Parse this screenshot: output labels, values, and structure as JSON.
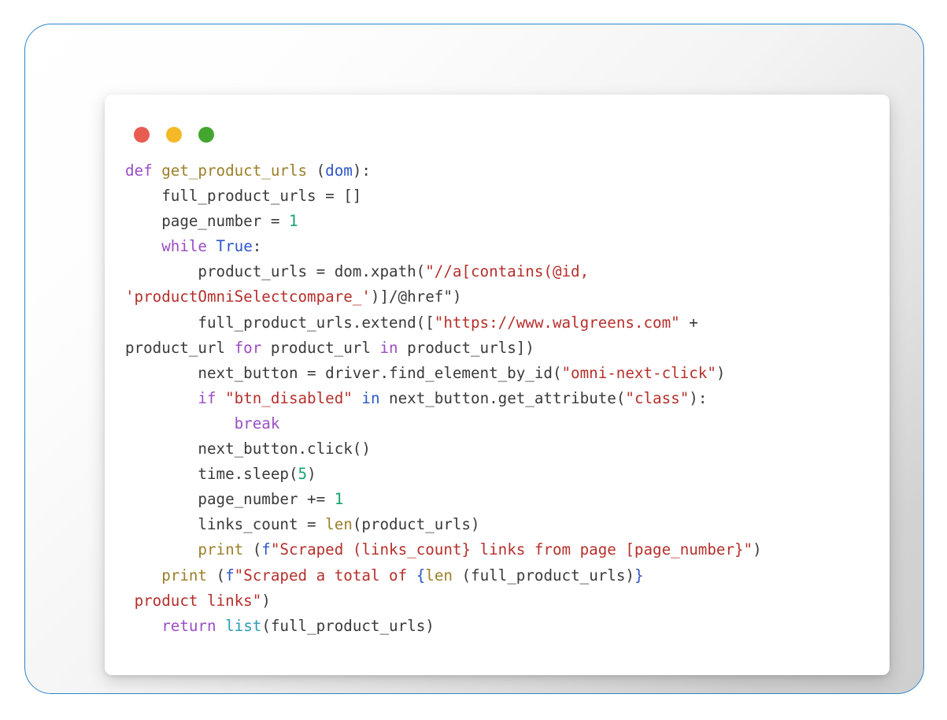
{
  "window": {
    "title": "Code snippet",
    "dots": [
      {
        "name": "close-dot",
        "color": "#e85c52"
      },
      {
        "name": "minimize-dot",
        "color": "#f5b928"
      },
      {
        "name": "maximize-dot",
        "color": "#43a62f"
      }
    ]
  },
  "frame": {
    "border_color": "#2e86c8",
    "background_gradient_from": "#ffffff",
    "background_gradient_to": "#cfcfcf"
  },
  "theme": {
    "card_background": "#ffffff",
    "text_color": "#3a3a3a",
    "keyword_color": "#9a4ec4",
    "keyword_alt_color": "#2c56c9",
    "function_color": "#9b8029",
    "string_color": "#b5302b",
    "number_color": "#13a36b",
    "builtin_color": "#2a9bb5"
  },
  "code": {
    "language": "python",
    "plain_text": "def get_product_urls (dom):\n    full_product_urls = []\n    page_number = 1\n    while True:\n        product_urls = dom.xpath(\"//a[contains(@id,\n'productOmniSelectcompare_')]/@href\")\n        full_product_urls.extend([\"https://www.walgreens.com\" +\nproduct_url for product_url in product_urls])\n        next_button = driver.find_element_by_id(\"omni-next-click\")\n        if \"btn_disabled\" in next_button.get_attribute(\"class\"):\n            break\n        next_button.click()\n        time.sleep(5)\n        page_number += 1\n        links_count = len(product_urls)\n        print (f\"Scraped (links_count} links from page [page_number}\")\n    print (f\"Scraped a total of {len (full_product_urls)}\n product links\")\n    return list(full_product_urls)",
    "lines": [
      "def get_product_urls (dom):",
      "    full_product_urls = []",
      "    page_number = 1",
      "    while True:",
      "        product_urls = dom.xpath(\"//a[contains(@id,",
      "'productOmniSelectcompare_')]/@href\")",
      "        full_product_urls.extend([\"https://www.walgreens.com\" +",
      "product_url for product_url in product_urls])",
      "        next_button = driver.find_element_by_id(\"omni-next-click\")",
      "        if \"btn_disabled\" in next_button.get_attribute(\"class\"):",
      "            break",
      "        next_button.click()",
      "        time.sleep(5)",
      "        page_number += 1",
      "        links_count = len(product_urls)",
      "        print (f\"Scraped (links_count} links from page [page_number}\")",
      "    print (f\"Scraped a total of {len (full_product_urls)}",
      " product links\")",
      "    return list(full_product_urls)"
    ],
    "tokens": [
      [
        {
          "t": "def",
          "c": "kw"
        },
        {
          "t": " ",
          "c": "plain"
        },
        {
          "t": "get_product_urls",
          "c": "fn"
        },
        {
          "t": " (",
          "c": "plain"
        },
        {
          "t": "dom",
          "c": "kw2"
        },
        {
          "t": "):",
          "c": "plain"
        }
      ],
      [
        {
          "t": "    full_product_urls = []",
          "c": "plain"
        }
      ],
      [
        {
          "t": "    page_number = ",
          "c": "plain"
        },
        {
          "t": "1",
          "c": "num"
        }
      ],
      [
        {
          "t": "    ",
          "c": "plain"
        },
        {
          "t": "while",
          "c": "kw"
        },
        {
          "t": " ",
          "c": "plain"
        },
        {
          "t": "True",
          "c": "kw2"
        },
        {
          "t": ":",
          "c": "plain"
        }
      ],
      [
        {
          "t": "        product_urls = dom.xpath(",
          "c": "plain"
        },
        {
          "t": "\"//a[contains(@id,",
          "c": "str"
        }
      ],
      [
        {
          "t": "'productOmniSelectcompare_'",
          "c": "str"
        },
        {
          "t": ")]/@href\")",
          "c": "plain"
        }
      ],
      [
        {
          "t": "        full_product_urls.extend([",
          "c": "plain"
        },
        {
          "t": "\"https://www.walgreens.com\"",
          "c": "str"
        },
        {
          "t": " +",
          "c": "plain"
        }
      ],
      [
        {
          "t": "product_url ",
          "c": "plain"
        },
        {
          "t": "for",
          "c": "kw"
        },
        {
          "t": " product_url ",
          "c": "plain"
        },
        {
          "t": "in",
          "c": "kw"
        },
        {
          "t": " product_urls])",
          "c": "plain"
        }
      ],
      [
        {
          "t": "        next_button = driver.find_element_by_id(",
          "c": "plain"
        },
        {
          "t": "\"omni-next-click\"",
          "c": "str"
        },
        {
          "t": ")",
          "c": "plain"
        }
      ],
      [
        {
          "t": "        ",
          "c": "plain"
        },
        {
          "t": "if",
          "c": "kw"
        },
        {
          "t": " ",
          "c": "plain"
        },
        {
          "t": "\"btn_disabled\"",
          "c": "str"
        },
        {
          "t": " ",
          "c": "plain"
        },
        {
          "t": "in",
          "c": "kw2"
        },
        {
          "t": " next_button.get_attribute(",
          "c": "plain"
        },
        {
          "t": "\"class\"",
          "c": "str"
        },
        {
          "t": "):",
          "c": "plain"
        }
      ],
      [
        {
          "t": "            ",
          "c": "plain"
        },
        {
          "t": "break",
          "c": "kw"
        }
      ],
      [
        {
          "t": "        next_button.click()",
          "c": "plain"
        }
      ],
      [
        {
          "t": "        time.sleep(",
          "c": "plain"
        },
        {
          "t": "5",
          "c": "num"
        },
        {
          "t": ")",
          "c": "plain"
        }
      ],
      [
        {
          "t": "        page_number += ",
          "c": "plain"
        },
        {
          "t": "1",
          "c": "num"
        }
      ],
      [
        {
          "t": "        links_count = ",
          "c": "plain"
        },
        {
          "t": "len",
          "c": "fn"
        },
        {
          "t": "(product_urls)",
          "c": "plain"
        }
      ],
      [
        {
          "t": "        ",
          "c": "plain"
        },
        {
          "t": "print",
          "c": "fn"
        },
        {
          "t": " (",
          "c": "plain"
        },
        {
          "t": "f",
          "c": "kw2"
        },
        {
          "t": "\"Scraped (links_count} links from page [page_number}\"",
          "c": "str"
        },
        {
          "t": ")",
          "c": "plain"
        }
      ],
      [
        {
          "t": "    ",
          "c": "plain"
        },
        {
          "t": "print",
          "c": "fn"
        },
        {
          "t": " (",
          "c": "plain"
        },
        {
          "t": "f",
          "c": "kw2"
        },
        {
          "t": "\"Scraped a total of ",
          "c": "str"
        },
        {
          "t": "{",
          "c": "kw2"
        },
        {
          "t": "len",
          "c": "fn"
        },
        {
          "t": " (full_product_urls)",
          "c": "plain"
        },
        {
          "t": "}",
          "c": "kw2"
        }
      ],
      [
        {
          "t": " product links\"",
          "c": "str"
        },
        {
          "t": ")",
          "c": "plain"
        }
      ],
      [
        {
          "t": "    ",
          "c": "plain"
        },
        {
          "t": "return",
          "c": "kw"
        },
        {
          "t": " ",
          "c": "plain"
        },
        {
          "t": "list",
          "c": "blt"
        },
        {
          "t": "(full_product_urls)",
          "c": "plain"
        }
      ]
    ]
  }
}
